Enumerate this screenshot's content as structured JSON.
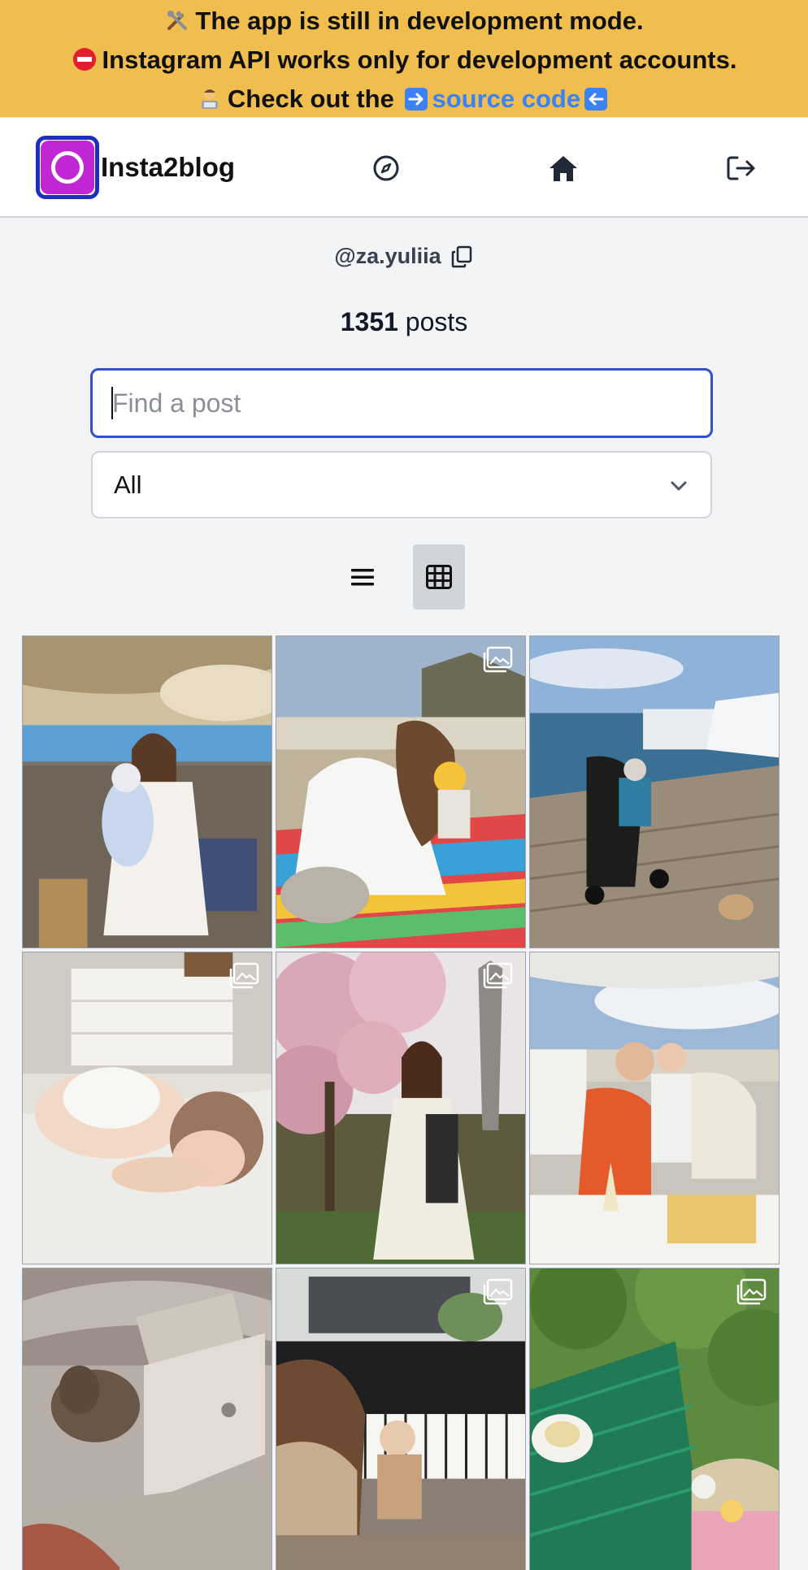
{
  "banner": {
    "line1": "The app is still in development mode.",
    "line2": "Instagram API works only for development accounts.",
    "line3_prefix": "Check out the",
    "line3_link": "source code",
    "icons": [
      "tools-emoji",
      "no-entry-emoji",
      "technologist-emoji",
      "right-arrow-emoji",
      "left-arrow-emoji"
    ]
  },
  "nav": {
    "brand": "Insta2blog",
    "icons": [
      "compass-icon",
      "home-icon",
      "logout-icon"
    ]
  },
  "profile": {
    "username": "@za.yuliia",
    "posts_number": "1351",
    "posts_label": "posts"
  },
  "search": {
    "placeholder": "Find a post",
    "value": ""
  },
  "filter": {
    "selected": "All"
  },
  "view": {
    "active": "grid"
  },
  "colors": {
    "banner": "#f0bd4f",
    "link": "#3b82f6",
    "focus": "#2f4fd4",
    "logo_border": "#1e2fbf",
    "logo_fill": "#c026d3"
  },
  "grid": {
    "posts": [
      {
        "scene": "restaurant-terrace-mother-baby",
        "multi": false
      },
      {
        "scene": "beach-picnic-girl",
        "multi": true
      },
      {
        "scene": "marina-stroller-dog",
        "multi": false
      },
      {
        "scene": "baby-sleeping-bed",
        "multi": true
      },
      {
        "scene": "blossom-paris-woman",
        "multi": true
      },
      {
        "scene": "seaside-family-lunch",
        "multi": false
      },
      {
        "scene": "laptop-elephant-toy",
        "multi": false
      },
      {
        "scene": "piano-mother-baby",
        "multi": true
      },
      {
        "scene": "garden-table-child",
        "multi": true
      }
    ]
  }
}
